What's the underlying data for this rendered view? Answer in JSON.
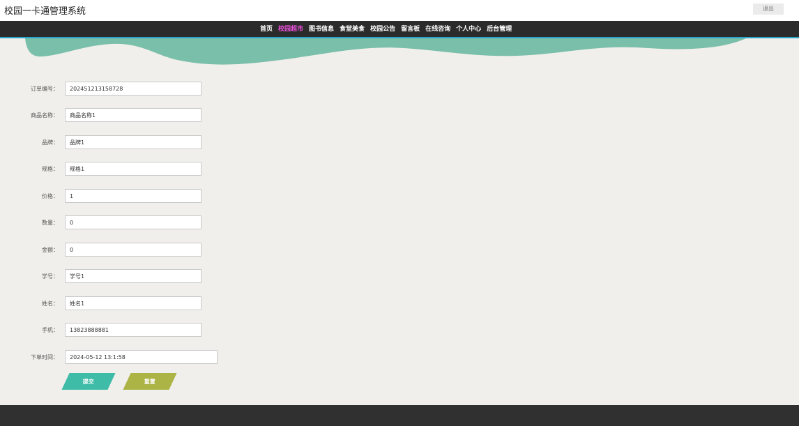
{
  "header": {
    "app_title": "校园一卡通管理系统",
    "logout_label": "退出"
  },
  "nav": {
    "items": [
      {
        "label": "首页",
        "active": false
      },
      {
        "label": "校园超市",
        "active": true
      },
      {
        "label": "图书信息",
        "active": false
      },
      {
        "label": "食堂美食",
        "active": false
      },
      {
        "label": "校园公告",
        "active": false
      },
      {
        "label": "留言板",
        "active": false
      },
      {
        "label": "在线咨询",
        "active": false
      },
      {
        "label": "个人中心",
        "active": false
      },
      {
        "label": "后台管理",
        "active": false
      }
    ],
    "active_color": "#e94fd9"
  },
  "form": {
    "fields": [
      {
        "label": "订单编号：",
        "value": "202451213158728"
      },
      {
        "label": "商品名称：",
        "value": "商品名称1"
      },
      {
        "label": "品牌：",
        "value": "品牌1"
      },
      {
        "label": "规格：",
        "value": "规格1"
      },
      {
        "label": "价格：",
        "value": "1"
      },
      {
        "label": "数量：",
        "value": "0"
      },
      {
        "label": "金额：",
        "value": "0"
      },
      {
        "label": "学号：",
        "value": "学号1"
      },
      {
        "label": "姓名：",
        "value": "姓名1"
      },
      {
        "label": "手机：",
        "value": "13823888881"
      },
      {
        "label": "下单时间：",
        "value": "2024-05-12 13:1:58"
      }
    ],
    "submit_label": "提交",
    "reset_label": "重置"
  },
  "colors": {
    "nav_bg": "#2b2b2b",
    "wave": "#7abfa9",
    "submit": "#3fbca8",
    "reset": "#abb444",
    "footer": "#303030"
  }
}
